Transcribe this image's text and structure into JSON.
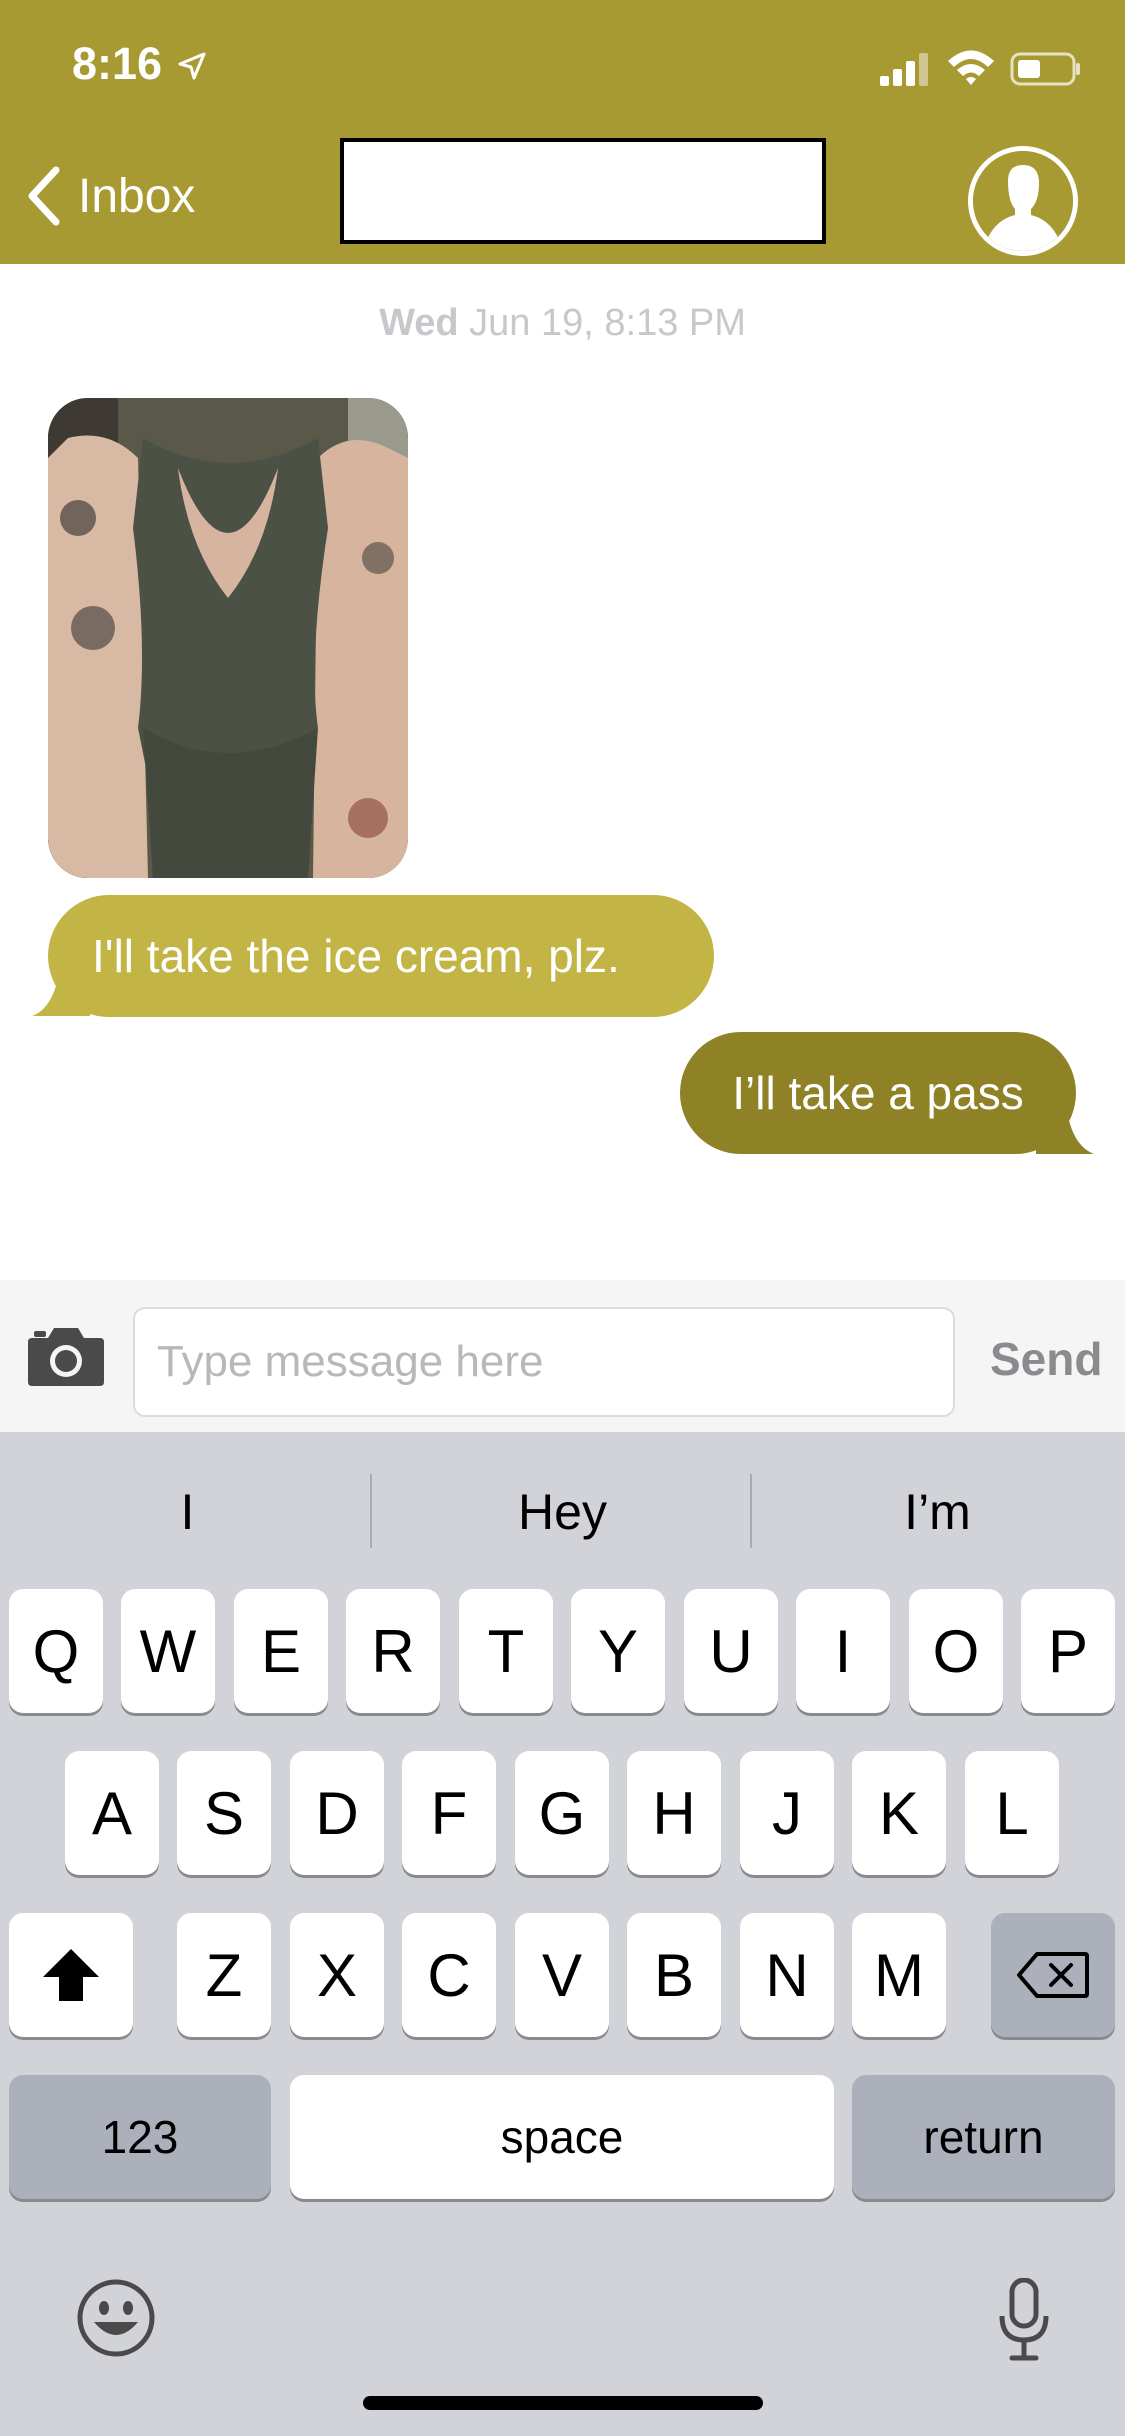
{
  "status_bar": {
    "time": "8:16"
  },
  "header": {
    "back_label": "Inbox",
    "title": ""
  },
  "conversation": {
    "timestamp_day": "Wed",
    "timestamp_rest": "Jun 19, 8:13 PM",
    "messages": [
      {
        "direction": "incoming",
        "text": "I'll take the ice cream, plz."
      },
      {
        "direction": "outgoing",
        "text": "I’ll take a pass"
      }
    ]
  },
  "composer": {
    "placeholder": "Type message here",
    "send_label": "Send"
  },
  "keyboard": {
    "suggestions": [
      "I",
      "Hey",
      "I’m"
    ],
    "row1": [
      "Q",
      "W",
      "E",
      "R",
      "T",
      "Y",
      "U",
      "I",
      "O",
      "P"
    ],
    "row2": [
      "A",
      "S",
      "D",
      "F",
      "G",
      "H",
      "J",
      "K",
      "L"
    ],
    "row3": [
      "Z",
      "X",
      "C",
      "V",
      "B",
      "N",
      "M"
    ],
    "numbers_label": "123",
    "space_label": "space",
    "return_label": "return"
  },
  "colors": {
    "header": "#a89a33",
    "incoming_bubble": "#c3b545",
    "outgoing_bubble": "#8f8126",
    "keyboard_bg": "#d1d3d9"
  }
}
